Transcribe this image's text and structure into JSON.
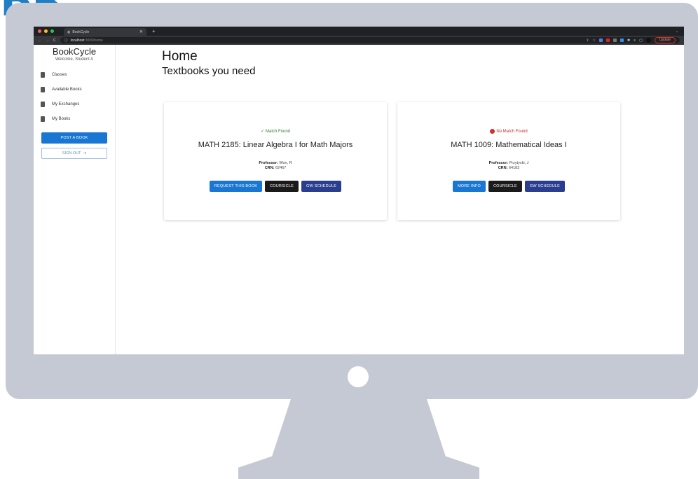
{
  "browser": {
    "tab_title": "BookCycle",
    "new_tab_symbol": "+",
    "url_host": "localhost",
    "url_path": ":3000/home",
    "update_label": "Update"
  },
  "sidebar": {
    "brand": "BookCycle",
    "welcome": "Welcome, Student A",
    "items": [
      {
        "label": "Classes",
        "icon": "book-icon"
      },
      {
        "label": "Available Books",
        "icon": "book-icon"
      },
      {
        "label": "My Exchanges",
        "icon": "books-icon"
      },
      {
        "label": "My Books",
        "icon": "book-icon"
      }
    ],
    "post_label": "POST A BOOK",
    "signout_label": "SIGN OUT"
  },
  "main": {
    "title": "Home",
    "subtitle": "Textbooks you need",
    "cards": [
      {
        "status": "Match Found",
        "status_type": "ok",
        "course": "MATH 2185: Linear Algebra I for Math Majors",
        "professor_label": "Professor:",
        "professor": "Won, R",
        "crn_label": "CRN:",
        "crn": "62467",
        "buttons": [
          "REQUEST THIS BOOK",
          "COURSICLE",
          "GW SCHEDULE"
        ]
      },
      {
        "status": "No Match Found",
        "status_type": "bad",
        "course": "MATH 1009: Mathematical Ideas I",
        "professor_label": "Professor:",
        "professor": "Przytycki, J",
        "crn_label": "CRN:",
        "crn": "64182",
        "buttons": [
          "MORE INFO",
          "COURSICLE",
          "GW SCHEDULE"
        ]
      }
    ]
  },
  "colors": {
    "primary": "#1976d2",
    "navy": "#2a3d8f",
    "success": "#2e7d32",
    "error": "#c62828",
    "monitor": "#c5c9d4"
  }
}
